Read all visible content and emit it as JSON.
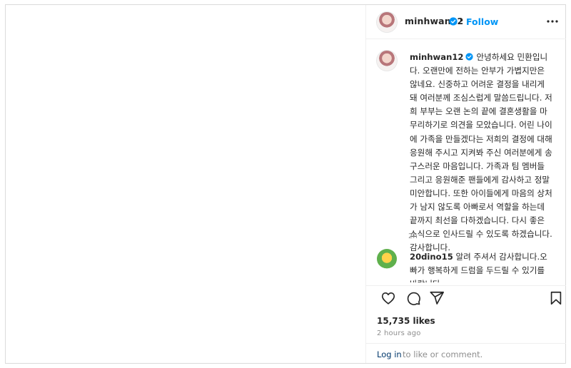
{
  "post": {
    "username": "minhwan12",
    "separator": "•",
    "follow_label": "Follow",
    "caption_username": "minhwan12",
    "caption_text": "안녕하세요 민환입니다. 오랜만에 전하는 안부가 가볍지만은 않네요. 신중하고 어려운 결정을 내리게 돼 여러분께 조심스럽게 말씀드립니다. 저희 부부는 오랜 논의 끝에 결혼생활을 마무리하기로 의견을 모았습니다. 어린 나이에 가족을 만들겠다는 저희의 결정에 대해 응원해 주시고 지켜봐 주신 여러분에게 송구스러운 마음입니다. 가족과 팀 멤버들 그리고 응원해준 팬들에게 감사하고 정말 미안합니다. 또한 아이들에게 마음의 상처가 남지 않도록 아빠로서 역할을 하는데 끝까지 최선을 다하겠습니다. 다시 좋은 소식으로 인사드릴 수 있도록 하겠습니다. 감사합니다.",
    "caption_time": "2h",
    "likes": "15,735 likes",
    "posted_ago": "2 hours ago"
  },
  "comments": [
    {
      "username": "20dino15",
      "text": "알려 주셔서 감사합니다.오빠가 행복하게 드럼을 두드릴 수 있기를 바랍니다"
    }
  ],
  "footer": {
    "login_link": "Log in",
    "login_rest": "to like or comment."
  },
  "icons": {
    "more": "more-options-icon",
    "verified": "verified-badge-icon",
    "like": "heart-icon",
    "comment": "comment-icon",
    "share": "share-icon",
    "save": "bookmark-icon"
  },
  "colors": {
    "link_blue": "#0095f6",
    "verified_blue": "#0095f6",
    "muted": "#8e8e8e",
    "text": "#262626"
  }
}
